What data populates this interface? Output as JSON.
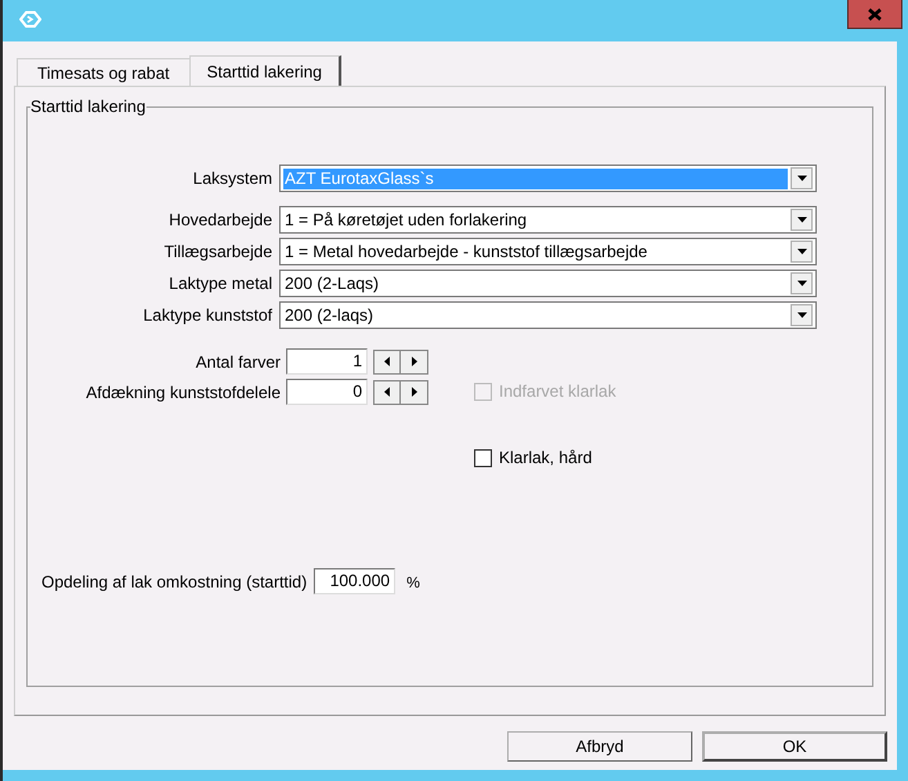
{
  "tabs": [
    {
      "label": "Timesats og rabat",
      "selected": false
    },
    {
      "label": "Starttid lakering",
      "selected": true
    }
  ],
  "group": {
    "title": "Starttid lakering"
  },
  "combos": [
    {
      "label": "Laksystem",
      "value": "AZT EurotaxGlass`s",
      "highlighted": true
    },
    {
      "label": "Hovedarbejde",
      "value": "1 = På køretøjet uden forlakering",
      "highlighted": false
    },
    {
      "label": "Tillægsarbejde",
      "value": "1 = Metal hovedarbejde - kunststof tillægsarbejde",
      "highlighted": false
    },
    {
      "label": "Laktype metal",
      "value": "200 (2-Laqs)",
      "highlighted": false
    },
    {
      "label": "Laktype kunststof",
      "value": "200 (2-laqs)",
      "highlighted": false
    }
  ],
  "spinners": [
    {
      "label": "Antal farver",
      "value": "1"
    },
    {
      "label": "Afdækning kunststofdelele",
      "value": "0"
    }
  ],
  "checkboxes": [
    {
      "label": "Indfarvet klarlak",
      "checked": false,
      "disabled": true
    },
    {
      "label": "Klarlak, hård",
      "checked": false,
      "disabled": false
    }
  ],
  "split": {
    "label": "Opdeling af lak omkostning (starttid)",
    "value": "100.000",
    "unit": "%"
  },
  "buttons": [
    "Afbryd",
    "OK"
  ]
}
